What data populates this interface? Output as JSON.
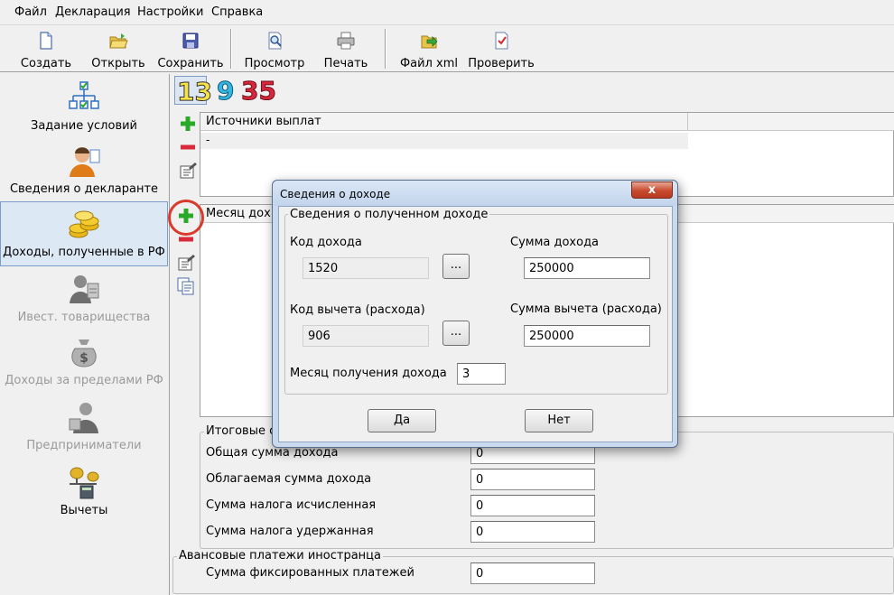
{
  "menu": {
    "items": [
      "Файл",
      "Декларация",
      "Настройки",
      "Справка"
    ]
  },
  "toolbar": {
    "buttons": [
      {
        "label": "Создать",
        "icon": "new-file-icon"
      },
      {
        "label": "Открыть",
        "icon": "open-folder-icon"
      },
      {
        "label": "Сохранить",
        "icon": "floppy-disk-icon"
      },
      {
        "label": "Просмотр",
        "icon": "magnifier-document-icon"
      },
      {
        "label": "Печать",
        "icon": "printer-icon"
      },
      {
        "label": "Файл xml",
        "icon": "xml-export-icon"
      },
      {
        "label": "Проверить",
        "icon": "check-document-icon"
      }
    ]
  },
  "sidebar": {
    "items": [
      {
        "label": "Задание условий",
        "icon": "tree-checkbox-icon",
        "state": "normal"
      },
      {
        "label": "Сведения о декларанте",
        "icon": "person-icon",
        "state": "normal"
      },
      {
        "label": "Доходы, полученные в РФ",
        "icon": "coins-icon",
        "state": "selected"
      },
      {
        "label": "Ивест. товарищества",
        "icon": "handshake-icon",
        "state": "disabled"
      },
      {
        "label": "Доходы за пределами РФ",
        "icon": "money-bag-icon",
        "state": "disabled"
      },
      {
        "label": "Предприниматели",
        "icon": "businessman-icon",
        "state": "disabled"
      },
      {
        "label": "Вычеты",
        "icon": "scales-calculator-icon",
        "state": "normal"
      }
    ]
  },
  "rates": {
    "a": "13",
    "b": "9",
    "c": "35",
    "colors": {
      "a": "#f5e14a",
      "b": "#35b6e0",
      "c": "#d8263d"
    }
  },
  "sources": {
    "header": "Источники выплат",
    "row": "-"
  },
  "income_grid": {
    "header": "Месяц дох..."
  },
  "totals": {
    "caption": "Итоговые с",
    "rows": [
      {
        "label": "Общая сумма дохода",
        "value": "0"
      },
      {
        "label": "Облагаемая сумма дохода",
        "value": "0"
      },
      {
        "label": "Сумма налога исчисленная",
        "value": "0"
      },
      {
        "label": "Сумма налога удержанная",
        "value": "0"
      }
    ]
  },
  "advance": {
    "caption": "Авансовые платежи иностранца",
    "label": "Сумма фиксированных платежей",
    "value": "0"
  },
  "dialog": {
    "title": "Сведения о доходе",
    "close": "x",
    "group": "Сведения о полученном доходе",
    "income_code_label": "Код дохода",
    "income_code_value": "1520",
    "income_sum_label": "Сумма дохода",
    "income_sum_value": "250000",
    "deduct_code_label": "Код вычета (расхода)",
    "deduct_code_value": "906",
    "deduct_sum_label": "Сумма вычета (расхода)",
    "deduct_sum_value": "250000",
    "month_label": "Месяц получения дохода",
    "month_value": "3",
    "browse": "...",
    "yes": "Да",
    "no": "Нет"
  }
}
